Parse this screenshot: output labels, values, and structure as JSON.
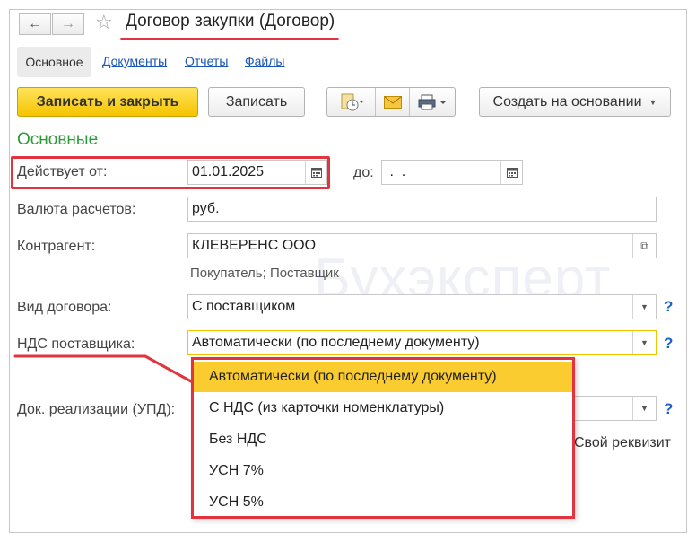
{
  "window": {
    "title": "Договор закупки (Договор)",
    "back_icon": "←",
    "forward_icon": "→",
    "star_icon": "☆"
  },
  "tabs": [
    "Основное",
    "Документы",
    "Отчеты",
    "Файлы"
  ],
  "toolbar": {
    "save_close": "Записать и закрыть",
    "save": "Записать",
    "create_based": "Создать на основании"
  },
  "section_title": "Основные",
  "form": {
    "valid_from_label": "Действует от:",
    "valid_from_value": "01.01.2025",
    "valid_to_label": "до:",
    "valid_to_value": " .  .",
    "currency_label": "Валюта расчетов:",
    "currency_value": "руб.",
    "counterparty_label": "Контрагент:",
    "counterparty_value": "КЛЕВЕРЕНС ООО",
    "counterparty_hint": "Покупатель; Поставщик",
    "contract_type_label": "Вид договора:",
    "contract_type_value": "С поставщиком",
    "vat_label": "НДС поставщика:",
    "vat_value": "Автоматически (по последнему документу)",
    "doc_label": "Док. реализации (УПД):",
    "own_requisite": "Свой реквизит",
    "help": "?"
  },
  "watermark": "Бухэксперт",
  "vat_options": [
    "Автоматически (по последнему документу)",
    "С НДС (из карточки номенклатуры)",
    "Без НДС",
    "УСН 7%",
    "УСН 5%"
  ],
  "colors": {
    "accent_red": "#e2343f",
    "primary_yellow": "#f5c400",
    "section_green": "#2e9b3a",
    "link_blue": "#1a56b8"
  }
}
